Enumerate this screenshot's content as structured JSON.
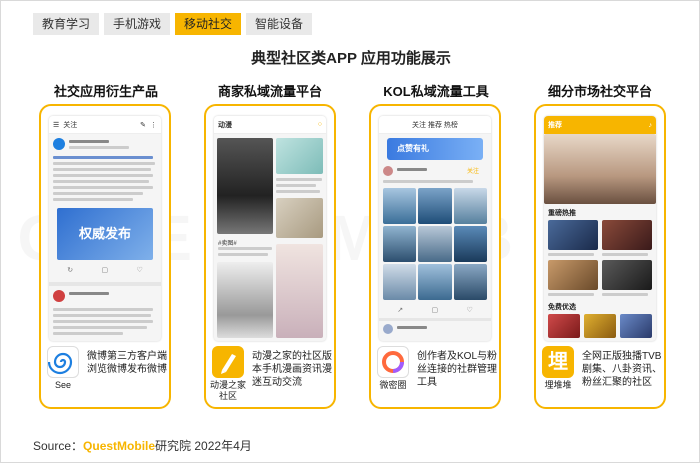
{
  "tabs": [
    "教育学习",
    "手机游戏",
    "移动社交",
    "智能设备"
  ],
  "active_tab": "移动社交",
  "main_title": "典型社区类APP 应用功能展示",
  "categories": [
    {
      "title": "社交应用衍生产品",
      "app_label": "See",
      "desc": "微博第三方客户端浏览微博发布微博",
      "phone_header": "关注"
    },
    {
      "title": "商家私域流量平台",
      "app_label": "动漫之家社区",
      "desc": "动漫之家的社区版本手机漫画资讯漫迷互动交流",
      "phone_header": "动漫"
    },
    {
      "title": "KOL私域流量工具",
      "app_label": "微密圈",
      "desc": "创作者及KOL与粉丝连接的社群管理工具",
      "phone_header": "关注 推荐 热榜"
    },
    {
      "title": "细分市场社交平台",
      "app_label": "埋堆堆",
      "desc": "全网正版独播TVB剧集、八卦资讯、粉丝汇聚的社区",
      "phone_header": "推荐"
    }
  ],
  "screen_text": {
    "weibo_user": "权威发布",
    "weibo_banner": "权威发布",
    "dongman_tag": "#卖图#",
    "weimi_banner": "点赞有礼",
    "maidui_section": "重磅热推",
    "maidui_section2": "免费优选"
  },
  "icons": {
    "see": "spiral-icon",
    "dongman": "pen-icon",
    "weimi": "ring-icon",
    "maidui": "mai-icon"
  },
  "colors": {
    "accent": "#f7b500",
    "weimi_ring": "#ff6a3d",
    "see_blue": "#1d7fe0"
  },
  "source": {
    "prefix": "Source：",
    "brand": "QuestMobile",
    "suffix": "研究院 2022年4月"
  },
  "watermark": "QUESTMOBILE"
}
